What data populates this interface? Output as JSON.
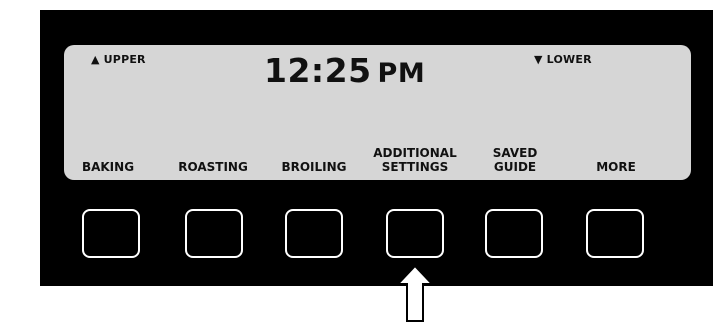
{
  "display": {
    "upper_label": "UPPER",
    "lower_label": "LOWER",
    "time": "12:25",
    "meridiem": "PM"
  },
  "icons": {
    "upper": "triangle-up-icon",
    "lower": "triangle-down-icon",
    "pointer": "up-arrow-icon"
  },
  "softkeys": [
    {
      "line1": "",
      "line2": "BAKING"
    },
    {
      "line1": "",
      "line2": "ROASTING"
    },
    {
      "line1": "",
      "line2": "BROILING"
    },
    {
      "line1": "ADDITIONAL",
      "line2": "SETTINGS"
    },
    {
      "line1": "SAVED",
      "line2": "GUIDE"
    },
    {
      "line1": "",
      "line2": "MORE"
    }
  ],
  "colors": {
    "panel": "#000000",
    "lcd": "#d6d6d6",
    "button_outline": "#ffffff"
  }
}
